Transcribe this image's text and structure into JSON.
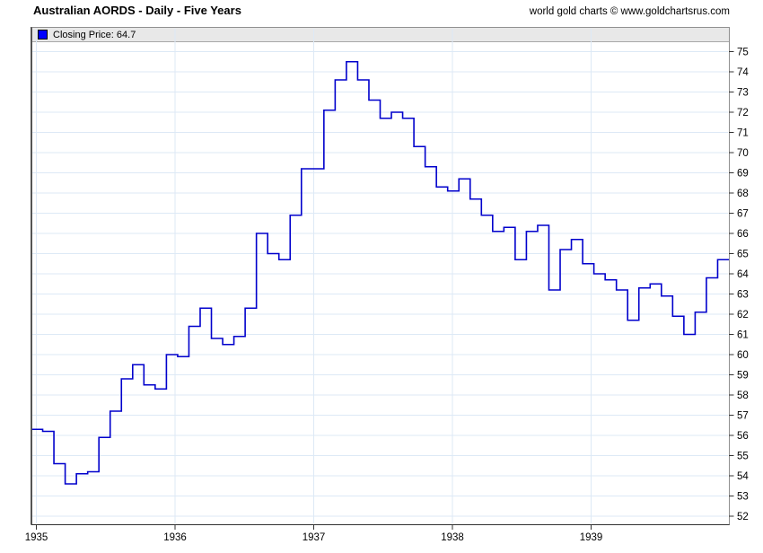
{
  "header": {
    "title": "Australian AORDS - Daily - Five Years",
    "credit": "world gold charts © www.goldchartsrus.com"
  },
  "legend": {
    "label": "Closing Price: 64.7",
    "swatch_color": "#0000ff"
  },
  "colors": {
    "line": "#0000cc",
    "grid": "#dde9f6",
    "axis": "#333333",
    "text": "#000000",
    "legend_bg": "#e8e8e8"
  },
  "chart_data": {
    "type": "line",
    "style": "step",
    "title": "Australian AORDS - Daily - Five Years",
    "series_name": "Closing Price",
    "last_value": 64.7,
    "x_axis": {
      "tick_labels": [
        "1935",
        "1936",
        "1937",
        "1938",
        "1939"
      ]
    },
    "y_axis": {
      "min": 52,
      "max": 75,
      "tick_step": 1
    },
    "legend_position": "top-left",
    "grid": true,
    "values": [
      56.3,
      56.2,
      54.6,
      53.6,
      54.1,
      54.2,
      55.9,
      57.2,
      58.8,
      59.5,
      58.5,
      58.3,
      60.0,
      59.9,
      61.4,
      62.3,
      60.8,
      60.5,
      60.9,
      62.3,
      66.0,
      65.0,
      64.7,
      66.9,
      69.2,
      69.2,
      72.1,
      73.6,
      74.5,
      73.6,
      72.6,
      71.7,
      72.0,
      71.7,
      70.3,
      69.3,
      68.3,
      68.1,
      68.7,
      67.7,
      66.9,
      66.1,
      66.3,
      64.7,
      66.1,
      66.4,
      63.2,
      65.2,
      65.7,
      64.5,
      64.0,
      63.7,
      63.2,
      61.7,
      63.3,
      63.5,
      62.9,
      61.9,
      61.0,
      62.1,
      63.8,
      64.7
    ]
  }
}
